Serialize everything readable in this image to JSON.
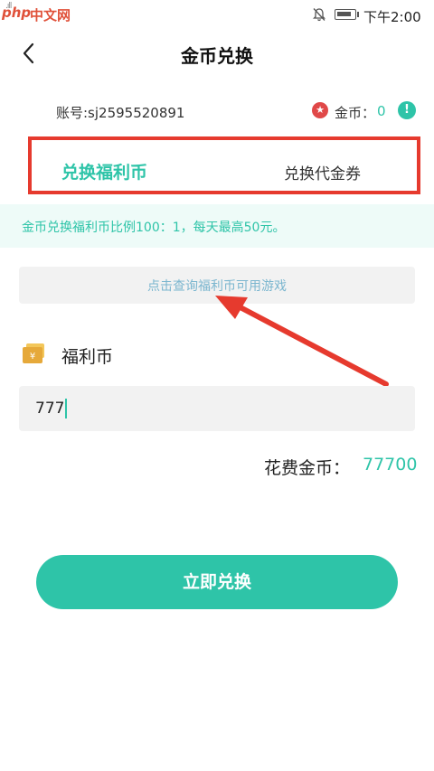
{
  "status_bar": {
    "watermark_logo": "php",
    "watermark_text": "中文网",
    "time": "下午2:00"
  },
  "header": {
    "title": "金币兑换"
  },
  "account": {
    "text": "账号:sj2595520891",
    "coin_label": "金币：",
    "coin_value": "0"
  },
  "tabs": [
    {
      "label": "兑换福利币",
      "active": true
    },
    {
      "label": "兑换代金券",
      "active": false
    }
  ],
  "notice": "金币兑换福利币比例100：1，每天最高50元。",
  "query_button": "点击查询福利币可用游戏",
  "currency_label": "福利币",
  "amount_input": {
    "value": "777"
  },
  "cost": {
    "label": "花费金币：",
    "value": "77700"
  },
  "submit_button": "立即兑换",
  "colors": {
    "accent": "#2ec4a8",
    "highlight_box": "#e63a2e",
    "arrow": "#e63a2e"
  }
}
